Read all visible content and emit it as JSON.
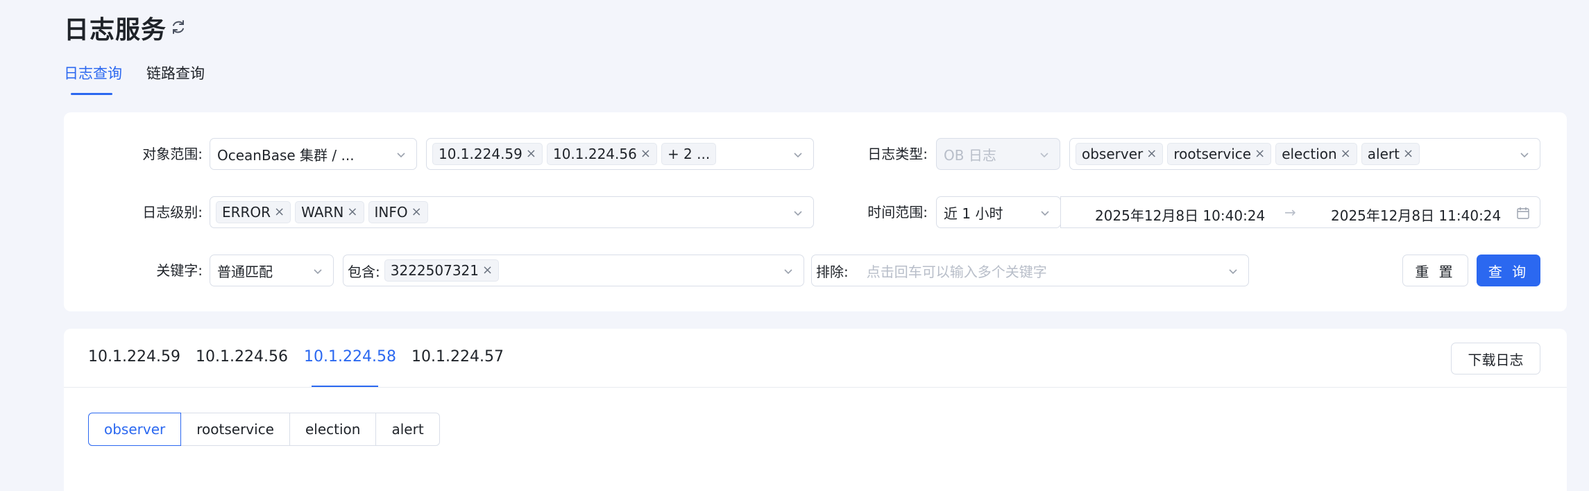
{
  "header": {
    "title": "日志服务",
    "refresh_icon": "refresh-icon",
    "tabs": [
      {
        "label": "日志查询",
        "active": true
      },
      {
        "label": "链路查询",
        "active": false
      }
    ]
  },
  "filters": {
    "scope": {
      "label": "对象范围:",
      "cluster_value": "OceanBase 集群 / ...",
      "host_tags": [
        "10.1.224.59",
        "10.1.224.56"
      ],
      "host_more": "+ 2 ..."
    },
    "log_type": {
      "label": "日志类型:",
      "type_value": "OB 日志",
      "tags": [
        "observer",
        "rootservice",
        "election",
        "alert"
      ]
    },
    "log_level": {
      "label": "日志级别:",
      "tags": [
        "ERROR",
        "WARN",
        "INFO"
      ]
    },
    "time_range": {
      "label": "时间范围:",
      "preset": "近 1 小时",
      "start": "2025年12月8日 10:40:24",
      "separator": "→",
      "end": "2025年12月8日 11:40:24"
    },
    "keyword": {
      "label": "关键字:",
      "match_mode": "普通匹配",
      "include_prefix": "包含:",
      "include_tags": [
        "3222507321"
      ],
      "exclude_prefix": "排除:",
      "exclude_placeholder": "点击回车可以输入多个关键字"
    },
    "buttons": {
      "reset": "重 置",
      "query": "查 询"
    }
  },
  "results": {
    "ip_tabs": [
      {
        "label": "10.1.224.59",
        "active": false
      },
      {
        "label": "10.1.224.56",
        "active": false
      },
      {
        "label": "10.1.224.58",
        "active": true
      },
      {
        "label": "10.1.224.57",
        "active": false
      }
    ],
    "download_label": "下载日志",
    "log_types": [
      {
        "label": "observer",
        "active": true
      },
      {
        "label": "rootservice",
        "active": false
      },
      {
        "label": "election",
        "active": false
      },
      {
        "label": "alert",
        "active": false
      }
    ]
  },
  "colors": {
    "accent": "#2b68f0",
    "background": "#f3f5fb",
    "card": "#ffffff"
  }
}
